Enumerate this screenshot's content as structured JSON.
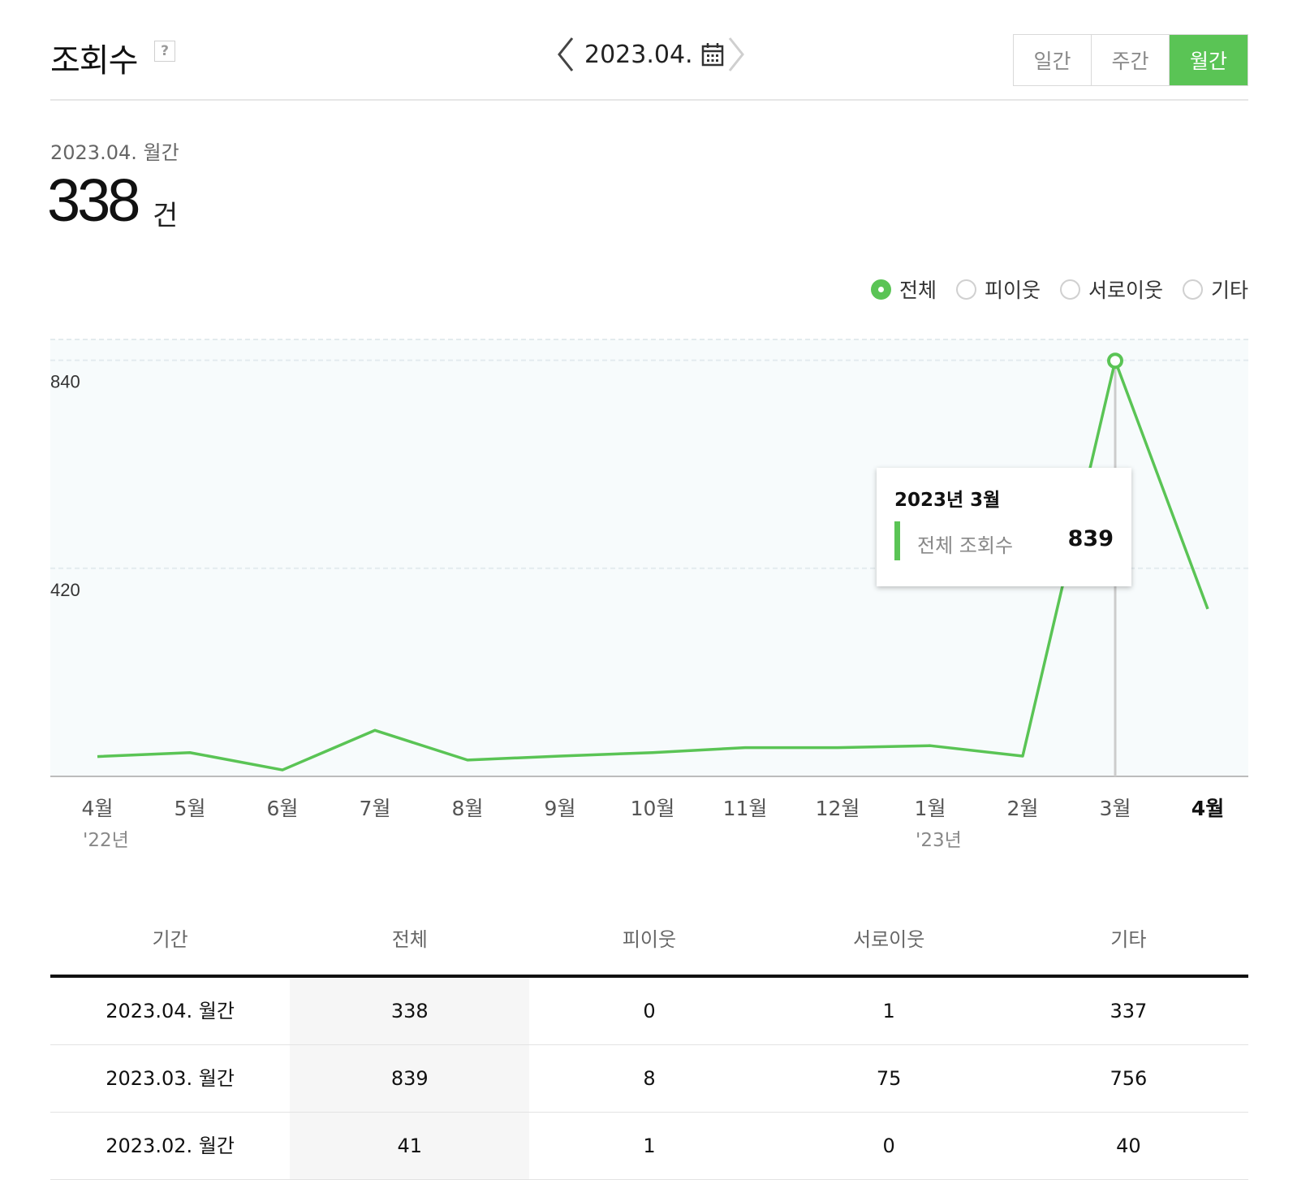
{
  "header": {
    "title": "조회수",
    "help_icon": "?",
    "date_label": "2023.04.",
    "tabs": [
      {
        "label": "일간",
        "active": false
      },
      {
        "label": "주간",
        "active": false
      },
      {
        "label": "월간",
        "active": true
      }
    ]
  },
  "summary": {
    "period": "2023.04. 월간",
    "value": "338",
    "unit": "건"
  },
  "filters": [
    {
      "label": "전체",
      "checked": true
    },
    {
      "label": "피이웃",
      "checked": false
    },
    {
      "label": "서로이웃",
      "checked": false
    },
    {
      "label": "기타",
      "checked": false
    }
  ],
  "colors": {
    "accent": "#5ac455",
    "plot_bg": "#f7fbfc",
    "grid": "#e3ebee"
  },
  "chart_data": {
    "type": "line",
    "categories": [
      "4월",
      "5월",
      "6월",
      "7월",
      "8월",
      "9월",
      "10월",
      "11월",
      "12월",
      "1월",
      "2월",
      "3월",
      "4월"
    ],
    "year_labels": [
      "'22년",
      "",
      "",
      "",
      "",
      "",
      "",
      "",
      "",
      "'23년",
      "",
      "",
      ""
    ],
    "values": [
      40,
      48,
      13,
      93,
      33,
      41,
      48,
      58,
      58,
      62,
      41,
      839,
      338
    ],
    "ylim": [
      0,
      882
    ],
    "yticks": [
      420,
      840
    ],
    "grid": true,
    "highlight_index": 11,
    "current_index": 12
  },
  "tooltip": {
    "title": "2023년 3월",
    "label": "전체 조회수",
    "value": "839"
  },
  "table": {
    "headers": [
      "기간",
      "전체",
      "피이웃",
      "서로이웃",
      "기타"
    ],
    "rows": [
      [
        "2023.04. 월간",
        "338",
        "0",
        "1",
        "337"
      ],
      [
        "2023.03. 월간",
        "839",
        "8",
        "75",
        "756"
      ],
      [
        "2023.02. 월간",
        "41",
        "1",
        "0",
        "40"
      ]
    ]
  }
}
